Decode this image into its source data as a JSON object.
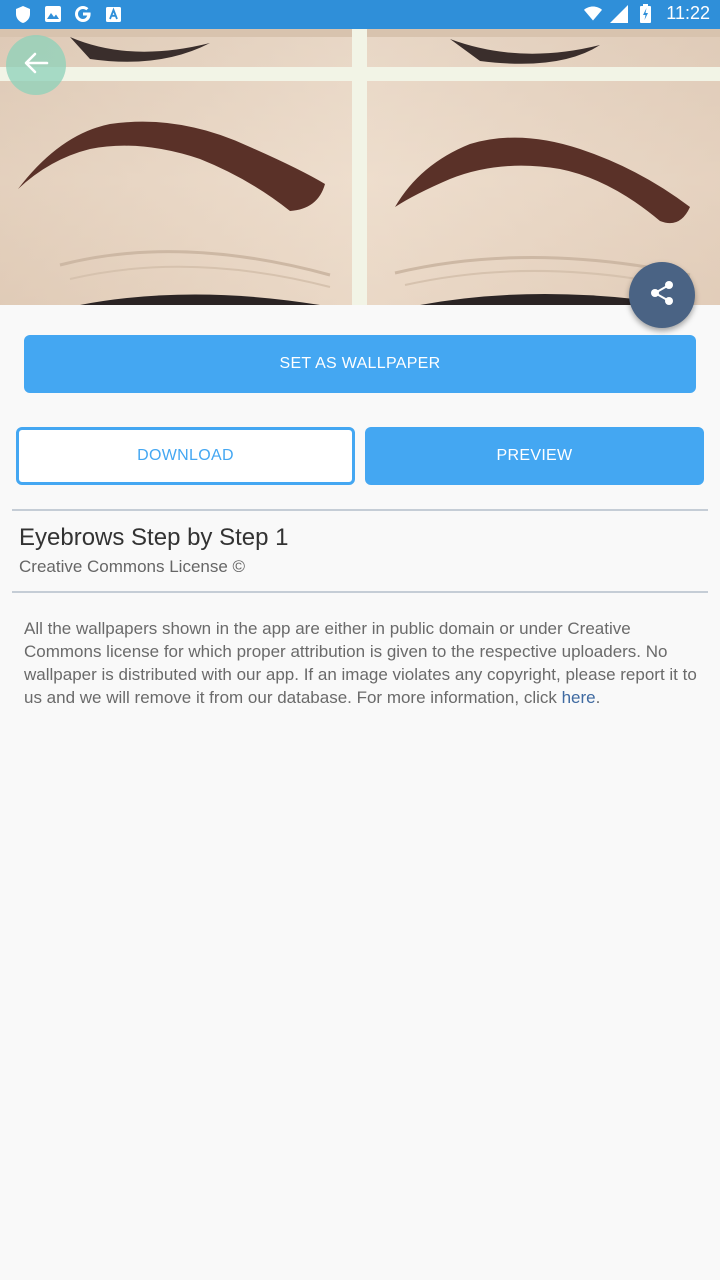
{
  "status_bar": {
    "time": "11:22",
    "left_icons": [
      "shield-icon",
      "image-icon",
      "google-icon",
      "font-icon"
    ],
    "right_icons": [
      "wifi-icon",
      "signal-icon",
      "battery-charging-icon"
    ]
  },
  "hero": {
    "icons": {
      "back": "arrow-left-icon",
      "share": "share-icon"
    }
  },
  "actions": {
    "set_wallpaper": "SET AS WALLPAPER",
    "download": "DOWNLOAD",
    "preview": "PREVIEW"
  },
  "details": {
    "title": "Eyebrows Step by Step 1",
    "license": "Creative Commons License ©"
  },
  "disclaimer": {
    "text": "All the wallpapers shown in the app are either in public domain or under Creative Commons license for which proper attribution is given to the respective uploaders. No wallpaper is distributed with our app. If an image violates any copyright, please report it to us and we will remove it from our database. For more information, click ",
    "link_label": "here",
    "suffix": "."
  },
  "colors": {
    "status_bar": "#2f8fd9",
    "accent": "#44a7f2",
    "share_button": "#4a6384",
    "link": "#3f6aa1"
  }
}
